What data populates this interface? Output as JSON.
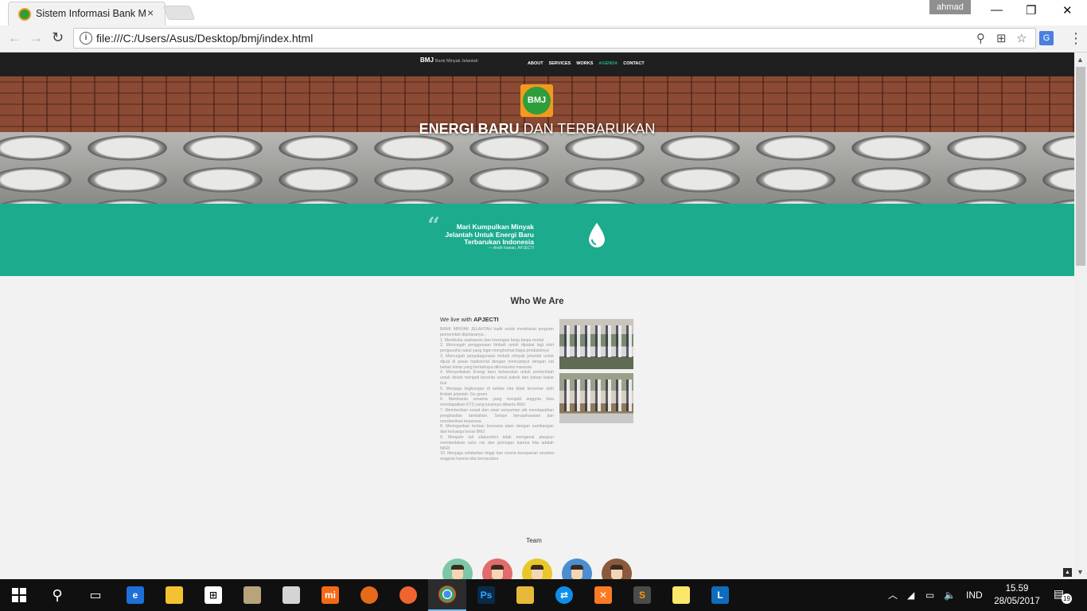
{
  "browser": {
    "tab_title": "Sistem Informasi Bank M",
    "tab_close": "×",
    "user": "ahmad",
    "url": "file:///C:/Users/Asus/Desktop/bmj/index.html"
  },
  "site": {
    "brand": "BMJ",
    "brand_sub": "Bank Minyak Jelantah",
    "nav": [
      "ABOUT",
      "SERVICES",
      "WORKS",
      "AGENDA",
      "CONTACT"
    ],
    "active_nav": "AGENDA",
    "hero": {
      "logo_text": "BMJ",
      "title_bold": "ENERGI BARU",
      "title_rest": " DAN TERBARUKAN"
    },
    "quote": {
      "text": "Mari Kumpulkan Minyak Jelantah Untuk Energi Baru Terbarukan Indonesia",
      "cite": "— Andri Irawan, APJECTI"
    },
    "who": {
      "title": "Who We Are",
      "live_prefix": "We live with ",
      "live_bold": "APJECTI",
      "paragraphs": [
        "BANK MINYAK JELANTAH hadir untuk membantu program pemerintah diantaranya :",
        "1. Membuka usahawan dan lowongan kerja tanpa modal",
        "2. Mencegah penggunaan limbah untuk dipakai lagi oleh pengusaha nakal yang ingin menghemat biaya produksinya",
        "3. Mencegah penyalagunaan limbah minyak jelantah untuk dijual di pasar tradisional dengan mencampur dengan zat bahan kimia yang berbahaya dikonsumsi manusia",
        "4. Menyediakan Energi baru terbarukan untuk pemerintah untuk diolah menjadi biosolar untuk pabrik dan bahan bakar bus",
        "5. Menjaga lingkungan di sekitar kita tidak tercemar oleh limbah jelantah. Go green",
        "6. Membantu sesama yang menjadi anggota bisa mendapatkan KTS yang iurannya dibantu BMJ",
        "7. Memberikan sosial dan siswi senyuman utk mendapatkan penghasilan tambahan. Selaye berusahaawan dan memberikan beasiswa",
        "8. Meringankan korban bencana alam dengan sumbangan dari keluarga besar BMJ",
        "9. Menjalin tali silaturahmi tidak mengenal ataupun membedakan suku ras dan golongan karena kita adalah NKRI",
        "10. Menjaga solidaritas tinggi dan norma kesopanan sesama anggota karena kita bersaudara"
      ]
    },
    "team": {
      "title": "Team",
      "avatar_colors": [
        "#7cc7a6",
        "#e26b6b",
        "#e8c72a",
        "#4a8fd0",
        "#8b5a3c"
      ]
    }
  },
  "taskbar": {
    "apps": [
      "start",
      "search",
      "task-view",
      "edge",
      "file-explorer",
      "store",
      "app-1",
      "app-2",
      "mi",
      "firefox",
      "app-3",
      "chrome",
      "photoshop",
      "app-4",
      "teamviewer",
      "xampp",
      "sublime",
      "sticky-notes",
      "lync"
    ],
    "lang": "IND",
    "time": "15.59",
    "date": "28/05/2017",
    "notifications": "19"
  },
  "colors": {
    "accent": "#1dab8e",
    "nav_bg": "#1f1f1f",
    "page_bg": "#f2f2f2"
  }
}
